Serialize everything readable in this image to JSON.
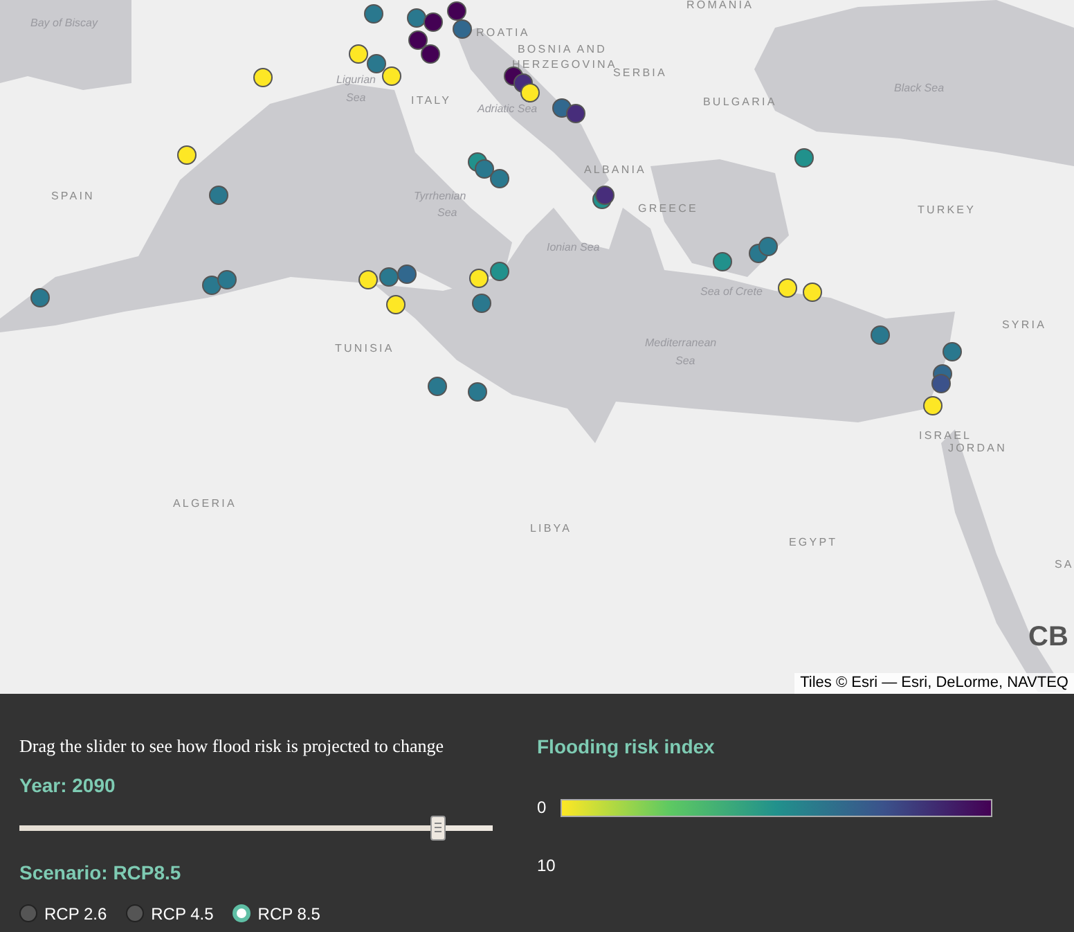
{
  "map": {
    "labels": [
      {
        "text": "Bay of Biscay",
        "kind": "water"
      },
      {
        "text": "ROMANIA",
        "kind": "country"
      },
      {
        "text": "ROATIA",
        "kind": "country"
      },
      {
        "text": "BOSNIA AND",
        "kind": "country"
      },
      {
        "text": "HERZEGOVINA",
        "kind": "country"
      },
      {
        "text": "SERBIA",
        "kind": "country"
      },
      {
        "text": "Ligurian",
        "kind": "water"
      },
      {
        "text": "Sea",
        "kind": "water"
      },
      {
        "text": "ITALY",
        "kind": "country"
      },
      {
        "text": "Adriatic Sea",
        "kind": "water"
      },
      {
        "text": "BULGARIA",
        "kind": "country"
      },
      {
        "text": "Black Sea",
        "kind": "water"
      },
      {
        "text": "SPAIN",
        "kind": "country"
      },
      {
        "text": "Tyrrhenian",
        "kind": "water"
      },
      {
        "text": "Sea",
        "kind": "water"
      },
      {
        "text": "ALBANIA",
        "kind": "country"
      },
      {
        "text": "GREECE",
        "kind": "country"
      },
      {
        "text": "TURKEY",
        "kind": "country"
      },
      {
        "text": "Ionian Sea",
        "kind": "water"
      },
      {
        "text": "Sea of Crete",
        "kind": "water"
      },
      {
        "text": "SYRIA",
        "kind": "country"
      },
      {
        "text": "TUNISIA",
        "kind": "country"
      },
      {
        "text": "Mediterranean",
        "kind": "water"
      },
      {
        "text": "Sea",
        "kind": "water"
      },
      {
        "text": "ISRAEL",
        "kind": "country"
      },
      {
        "text": "JORDAN",
        "kind": "country"
      },
      {
        "text": "ALGERIA",
        "kind": "country"
      },
      {
        "text": "LIBYA",
        "kind": "country"
      },
      {
        "text": "EGYPT",
        "kind": "country"
      },
      {
        "text": "SA",
        "kind": "country"
      }
    ],
    "markers": [
      {
        "color": "#2a788e"
      },
      {
        "color": "#2a788e"
      },
      {
        "color": "#440154"
      },
      {
        "color": "#440154"
      },
      {
        "color": "#31688e"
      },
      {
        "color": "#440154"
      },
      {
        "color": "#440154"
      },
      {
        "color": "#fde725"
      },
      {
        "color": "#2a788e"
      },
      {
        "color": "#fde725"
      },
      {
        "color": "#fde725"
      },
      {
        "color": "#440154"
      },
      {
        "color": "#472d7b"
      },
      {
        "color": "#fde725"
      },
      {
        "color": "#31688e"
      },
      {
        "color": "#472d7b"
      },
      {
        "color": "#fde725"
      },
      {
        "color": "#21918c"
      },
      {
        "color": "#2a788e"
      },
      {
        "color": "#2a788e"
      },
      {
        "color": "#21918c"
      },
      {
        "color": "#2a788e"
      },
      {
        "color": "#21918c"
      },
      {
        "color": "#472d7b"
      },
      {
        "color": "#21918c"
      },
      {
        "color": "#2a788e"
      },
      {
        "color": "#2a788e"
      },
      {
        "color": "#fde725"
      },
      {
        "color": "#fde725"
      },
      {
        "color": "#2a788e"
      },
      {
        "color": "#2a788e"
      },
      {
        "color": "#2a788e"
      },
      {
        "color": "#fde725"
      },
      {
        "color": "#2a788e"
      },
      {
        "color": "#31688e"
      },
      {
        "color": "#fde725"
      },
      {
        "color": "#fde725"
      },
      {
        "color": "#21918c"
      },
      {
        "color": "#2a788e"
      },
      {
        "color": "#2a788e"
      },
      {
        "color": "#2a788e"
      },
      {
        "color": "#31688e"
      },
      {
        "color": "#3b528b"
      },
      {
        "color": "#fde725"
      },
      {
        "color": "#2a788e"
      },
      {
        "color": "#2a788e"
      }
    ],
    "logo": "CB",
    "attribution": "Tiles © Esri — Esri, DeLorme, NAVTEQ"
  },
  "controls": {
    "instruction": "Drag the slider to see how flood risk is projected to change",
    "year_label": "Year: 2090",
    "slider": {
      "level": 0.885
    },
    "scenario_label": "Scenario: RCP8.5",
    "scenarios": [
      {
        "label": "RCP 2.6",
        "selected": false
      },
      {
        "label": "RCP 4.5",
        "selected": false
      },
      {
        "label": "RCP 8.5",
        "selected": true
      }
    ]
  },
  "legend": {
    "title": "Flooding risk index",
    "min_label": "0",
    "max_label": "10"
  }
}
